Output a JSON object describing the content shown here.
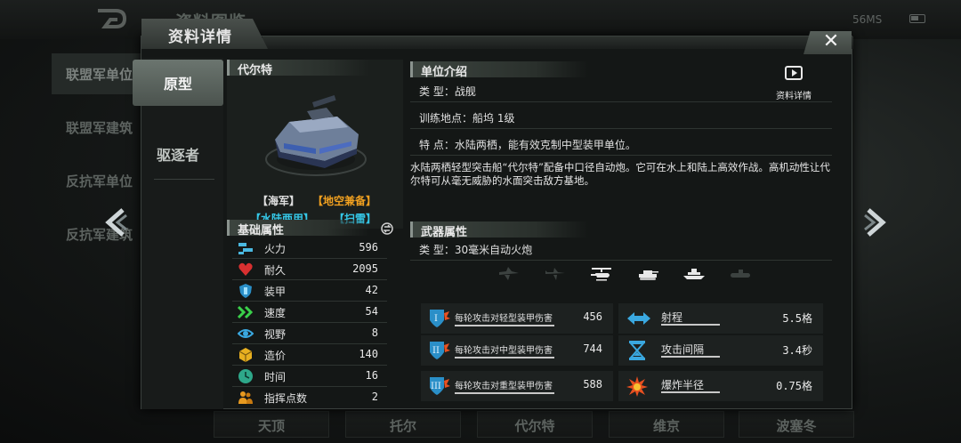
{
  "background": {
    "screen_title": "资料图鉴",
    "status": "56MS",
    "left_nav": [
      "联盟军单位",
      "联盟军建筑",
      "反抗军单位",
      "反抗军建筑"
    ],
    "bottom_nav": [
      "天顶",
      "托尔",
      "代尔特",
      "维京",
      "波塞冬"
    ]
  },
  "dialog": {
    "title": "资料详情",
    "close_label": "✕",
    "variants": [
      "原型",
      "驱逐者"
    ],
    "unit_name": "代尔特",
    "tags": {
      "faction": "【海军】",
      "capability": "【地空兼备】",
      "terrain": "【水陆两用】",
      "special": "【扫雷】"
    },
    "base_stats_title": "基础属性",
    "base_stats": [
      {
        "label": "火力",
        "value": "596",
        "icon": "firepower-icon"
      },
      {
        "label": "耐久",
        "value": "2095",
        "icon": "heart-icon"
      },
      {
        "label": "装甲",
        "value": "42",
        "icon": "shield-icon"
      },
      {
        "label": "速度",
        "value": "54",
        "icon": "speed-chevrons-icon"
      },
      {
        "label": "视野",
        "value": "8",
        "icon": "eye-icon"
      },
      {
        "label": "造价",
        "value": "140",
        "icon": "cost-cube-icon"
      },
      {
        "label": "时间",
        "value": "16",
        "icon": "clock-icon"
      },
      {
        "label": "指挥点数",
        "value": "2",
        "icon": "command-points-icon"
      }
    ],
    "intro_title": "单位介绍",
    "detail_button_label": "资料详情",
    "intro_rows": [
      {
        "key": "类    型：",
        "value": "战舰"
      },
      {
        "key": "训练地点：",
        "value": "船坞 1级"
      },
      {
        "key": "特    点：",
        "value": "水陆两栖，能有效克制中型装甲单位。"
      }
    ],
    "description": "水陆两栖轻型突击船“代尔特”配备中口径自动炮。它可在水上和陆上高效作战。高机动性让代尔特可从毫无威胁的水面突击敌方基地。",
    "weapon_title": "武器属性",
    "weapon_type": {
      "key": "类    型：",
      "value": "30毫米自动火炮"
    },
    "targets": [
      "jet-icon",
      "plane-icon",
      "helicopter-icon",
      "tank-icon",
      "ship-icon",
      "submarine-icon"
    ],
    "damage_stats": [
      {
        "label": "每轮攻击对轻型装甲伤害",
        "value": "456",
        "icon": "armor-light-icon"
      },
      {
        "label": "每轮攻击对中型装甲伤害",
        "value": "744",
        "icon": "armor-medium-icon"
      },
      {
        "label": "每轮攻击对重型装甲伤害",
        "value": "588",
        "icon": "armor-heavy-icon"
      }
    ],
    "other_stats": [
      {
        "label": "射程",
        "value": "5.5格",
        "icon": "range-arrows-icon"
      },
      {
        "label": "攻击间隔",
        "value": "3.4秒",
        "icon": "hourglass-icon"
      },
      {
        "label": "爆炸半径",
        "value": "0.75格",
        "icon": "explosion-icon"
      }
    ],
    "colors": {
      "tag_orange": "#f0a020",
      "tag_cyan": "#35c8e8",
      "accent_panel": "#4b534e"
    }
  }
}
